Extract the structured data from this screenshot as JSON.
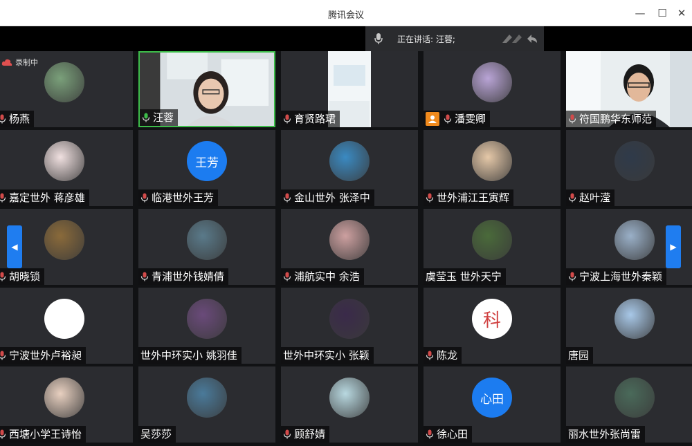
{
  "window": {
    "title": "腾讯会议",
    "controls": {
      "close_glyph": "✕",
      "maximize_glyph": "☐",
      "minimize_glyph": "—"
    }
  },
  "speaking": {
    "label": "正在讲话: 汪蓉;",
    "icon": "microphone-icon"
  },
  "recording": {
    "label": "录制中",
    "icon": "cloud-recording-icon"
  },
  "nav": {
    "prev_glyph": "◀",
    "next_glyph": "▶"
  },
  "participants": [
    {
      "name": "杨燕",
      "avatar": "photo"
    },
    {
      "name": "汪蓉",
      "avatar": "video",
      "mic": "green"
    },
    {
      "name": "育贤路珺",
      "avatar": "video-room"
    },
    {
      "name": "潘雯卿",
      "avatar": "photo",
      "host": true
    },
    {
      "name": "符国鹏华东师范",
      "avatar": "video-man"
    },
    {
      "name": "嘉定世外 蒋彦雄",
      "avatar": "photo"
    },
    {
      "name": "临港世外王芳",
      "avatar": "text",
      "avatar_text": "王芳",
      "avatar_color": "#1c7cf0"
    },
    {
      "name": "金山世外 张泽中",
      "avatar": "photo"
    },
    {
      "name": "世外浦江王寅辉",
      "avatar": "photo"
    },
    {
      "name": "赵叶滢",
      "avatar": "photo"
    },
    {
      "name": "胡晓锁",
      "avatar": "photo"
    },
    {
      "name": "青浦世外钱婧倩",
      "avatar": "photo"
    },
    {
      "name": "浦航实中 余浩",
      "avatar": "photo"
    },
    {
      "name": "虞莹玉 世外天宁",
      "avatar": "photo",
      "no_mic": true
    },
    {
      "name": "宁波上海世外秦颖",
      "avatar": "photo"
    },
    {
      "name": "宁波世外卢裕昶",
      "avatar": "blank"
    },
    {
      "name": "世外中环实小 姚羽佳",
      "avatar": "photo",
      "no_mic": true
    },
    {
      "name": "世外中环实小 张颖",
      "avatar": "photo",
      "no_mic": true
    },
    {
      "name": "陈龙",
      "avatar": "char",
      "avatar_text": "科"
    },
    {
      "name": "唐园",
      "avatar": "photo",
      "no_mic": true
    },
    {
      "name": "西塘小学王诗怡",
      "avatar": "photo"
    },
    {
      "name": "吴莎莎",
      "avatar": "photo",
      "no_mic": true
    },
    {
      "name": "顾舒婧",
      "avatar": "photo"
    },
    {
      "name": "徐心田",
      "avatar": "text",
      "avatar_text": "心田",
      "avatar_color": "#1c7cf0"
    },
    {
      "name": "丽水世外张尚雷",
      "avatar": "photo",
      "no_mic": true
    }
  ],
  "colors": {
    "tile": "#2b2c30",
    "bar": "#000000",
    "accent": "#1f7df0",
    "host": "#f08a1d",
    "mic_active": "#3dbd4a"
  }
}
